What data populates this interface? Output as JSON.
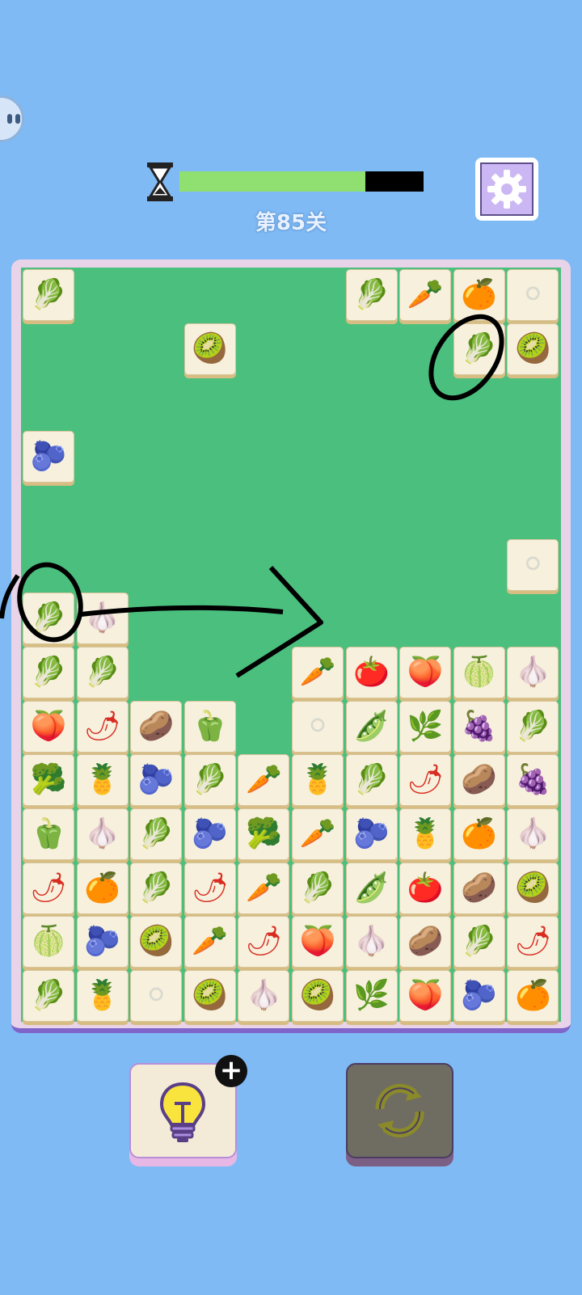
{
  "header": {
    "level_label": "第85关",
    "timer_fraction": 0.76,
    "timer_color": "#8fe070",
    "hourglass_icon": "hourglass-icon",
    "settings_icon": "gear-icon"
  },
  "side_button": {
    "icon": "robot-face-icon"
  },
  "board": {
    "background": "#4abf7e",
    "tiles": [
      {
        "row": 0,
        "col": 0,
        "item": "spinach"
      },
      {
        "row": 0,
        "col": 6,
        "item": "spinach"
      },
      {
        "row": 0,
        "col": 7,
        "item": "carrot"
      },
      {
        "row": 0,
        "col": 8,
        "item": "orange"
      },
      {
        "row": 0,
        "col": 9,
        "item": "radish"
      },
      {
        "row": 1,
        "col": 3,
        "item": "kiwi"
      },
      {
        "row": 1,
        "col": 8,
        "item": "cabbage"
      },
      {
        "row": 1,
        "col": 9,
        "item": "kiwi"
      },
      {
        "row": 3,
        "col": 0,
        "item": "blueberry"
      },
      {
        "row": 5,
        "col": 9,
        "item": "radish"
      },
      {
        "row": 6,
        "col": 0,
        "item": "cabbage"
      },
      {
        "row": 6,
        "col": 1,
        "item": "garlic"
      },
      {
        "row": 7,
        "col": 0,
        "item": "spinach"
      },
      {
        "row": 7,
        "col": 1,
        "item": "spinach"
      },
      {
        "row": 7,
        "col": 5,
        "item": "carrot"
      },
      {
        "row": 7,
        "col": 6,
        "item": "tomato"
      },
      {
        "row": 7,
        "col": 7,
        "item": "peach"
      },
      {
        "row": 7,
        "col": 8,
        "item": "dragonfruit"
      },
      {
        "row": 7,
        "col": 9,
        "item": "garlic"
      },
      {
        "row": 8,
        "col": 0,
        "item": "peach"
      },
      {
        "row": 8,
        "col": 1,
        "item": "pepper"
      },
      {
        "row": 8,
        "col": 2,
        "item": "potato"
      },
      {
        "row": 8,
        "col": 3,
        "item": "bellpepper"
      },
      {
        "row": 8,
        "col": 5,
        "item": "radish"
      },
      {
        "row": 8,
        "col": 6,
        "item": "peas"
      },
      {
        "row": 8,
        "col": 7,
        "item": "scallion"
      },
      {
        "row": 8,
        "col": 8,
        "item": "grapes"
      },
      {
        "row": 8,
        "col": 9,
        "item": "cabbage"
      },
      {
        "row": 9,
        "col": 0,
        "item": "broccoli"
      },
      {
        "row": 9,
        "col": 1,
        "item": "pineapple"
      },
      {
        "row": 9,
        "col": 2,
        "item": "blueberry"
      },
      {
        "row": 9,
        "col": 3,
        "item": "spinach"
      },
      {
        "row": 9,
        "col": 4,
        "item": "carrot"
      },
      {
        "row": 9,
        "col": 5,
        "item": "pineapple"
      },
      {
        "row": 9,
        "col": 6,
        "item": "cabbage"
      },
      {
        "row": 9,
        "col": 7,
        "item": "pepper"
      },
      {
        "row": 9,
        "col": 8,
        "item": "potato"
      },
      {
        "row": 9,
        "col": 9,
        "item": "grapes"
      },
      {
        "row": 10,
        "col": 0,
        "item": "bellpepper"
      },
      {
        "row": 10,
        "col": 1,
        "item": "garlic"
      },
      {
        "row": 10,
        "col": 2,
        "item": "spinach"
      },
      {
        "row": 10,
        "col": 3,
        "item": "blueberry"
      },
      {
        "row": 10,
        "col": 4,
        "item": "broccoli"
      },
      {
        "row": 10,
        "col": 5,
        "item": "carrot"
      },
      {
        "row": 10,
        "col": 6,
        "item": "blueberry"
      },
      {
        "row": 10,
        "col": 7,
        "item": "pineapple"
      },
      {
        "row": 10,
        "col": 8,
        "item": "orange"
      },
      {
        "row": 10,
        "col": 9,
        "item": "garlic"
      },
      {
        "row": 11,
        "col": 0,
        "item": "pepper"
      },
      {
        "row": 11,
        "col": 1,
        "item": "orange"
      },
      {
        "row": 11,
        "col": 2,
        "item": "cabbage"
      },
      {
        "row": 11,
        "col": 3,
        "item": "pepper"
      },
      {
        "row": 11,
        "col": 4,
        "item": "carrot"
      },
      {
        "row": 11,
        "col": 5,
        "item": "cabbage"
      },
      {
        "row": 11,
        "col": 6,
        "item": "peas"
      },
      {
        "row": 11,
        "col": 7,
        "item": "tomato"
      },
      {
        "row": 11,
        "col": 8,
        "item": "potato"
      },
      {
        "row": 11,
        "col": 9,
        "item": "kiwi"
      },
      {
        "row": 12,
        "col": 0,
        "item": "dragonfruit"
      },
      {
        "row": 12,
        "col": 1,
        "item": "blueberry"
      },
      {
        "row": 12,
        "col": 2,
        "item": "kiwi"
      },
      {
        "row": 12,
        "col": 3,
        "item": "carrot"
      },
      {
        "row": 12,
        "col": 4,
        "item": "pepper"
      },
      {
        "row": 12,
        "col": 5,
        "item": "peach"
      },
      {
        "row": 12,
        "col": 6,
        "item": "garlic"
      },
      {
        "row": 12,
        "col": 7,
        "item": "potato"
      },
      {
        "row": 12,
        "col": 8,
        "item": "cabbage"
      },
      {
        "row": 12,
        "col": 9,
        "item": "pepper"
      },
      {
        "row": 13,
        "col": 0,
        "item": "cabbage"
      },
      {
        "row": 13,
        "col": 1,
        "item": "pineapple"
      },
      {
        "row": 13,
        "col": 2,
        "item": "radish"
      },
      {
        "row": 13,
        "col": 3,
        "item": "kiwi"
      },
      {
        "row": 13,
        "col": 4,
        "item": "garlic"
      },
      {
        "row": 13,
        "col": 5,
        "item": "kiwi"
      },
      {
        "row": 13,
        "col": 6,
        "item": "scallion"
      },
      {
        "row": 13,
        "col": 7,
        "item": "peach"
      },
      {
        "row": 13,
        "col": 8,
        "item": "blueberry"
      },
      {
        "row": 13,
        "col": 9,
        "item": "orange"
      }
    ]
  },
  "glyphs": {
    "spinach": "🥬",
    "cabbage": "🥬",
    "carrot": "🥕",
    "orange": "🍊",
    "radish": "⚪",
    "kiwi": "🥝",
    "blueberry": "🫐",
    "garlic": "🧄",
    "tomato": "🍅",
    "peach": "🍑",
    "dragonfruit": "🍈",
    "pepper": "🌶",
    "potato": "🥔",
    "bellpepper": "🫑",
    "peas": "🫛",
    "scallion": "🌿",
    "grapes": "🍇",
    "broccoli": "🥦",
    "pineapple": "🍍"
  },
  "item_colors": {
    "spinach": "#3f9a3a",
    "cabbage": "#7bbf62",
    "carrot": "#f08a24",
    "orange": "#f39a1c",
    "radish": "#d9d9cf",
    "kiwi": "#7b8f2c",
    "blueberry": "#2b4fb8",
    "garlic": "#cfc7b7",
    "tomato": "#e0332e",
    "peach": "#f4a083",
    "dragonfruit": "#e6559b",
    "pepper": "#d92b1f",
    "potato": "#d9a850",
    "bellpepper": "#f2c41a",
    "peas": "#3e9b2e",
    "scallion": "#6db34a",
    "grapes": "#8a4fc7",
    "broccoli": "#2e8f2e",
    "pineapple": "#e8c330"
  },
  "buttons": {
    "hint": {
      "icon": "lightbulb-icon",
      "badge": "+"
    },
    "shuffle": {
      "icon": "refresh-icon"
    }
  },
  "annotations": {
    "marks": [
      "circle-top-right",
      "circle-left",
      "arrow-right"
    ]
  }
}
